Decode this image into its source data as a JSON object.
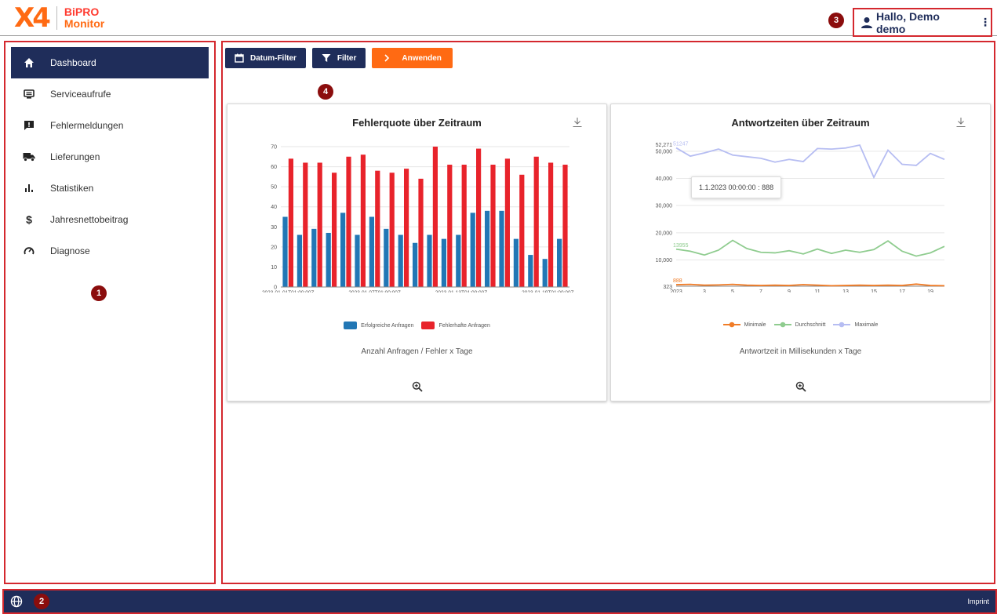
{
  "header": {
    "logo_mark": "X4",
    "logo_line1": "BiPRO",
    "logo_line2": "Monitor",
    "user_label": "Hallo, Demo demo",
    "menu_icon": "more-vert-icon"
  },
  "badges": [
    "1",
    "2",
    "3",
    "4"
  ],
  "sidebar": {
    "items": [
      {
        "label": "Dashboard",
        "icon": "home-icon",
        "active": true
      },
      {
        "label": "Serviceaufrufe",
        "icon": "monitor-icon",
        "active": false
      },
      {
        "label": "Fehlermeldungen",
        "icon": "error-message-icon",
        "active": false
      },
      {
        "label": "Lieferungen",
        "icon": "truck-icon",
        "active": false
      },
      {
        "label": "Statistiken",
        "icon": "bar-chart-icon",
        "active": false
      },
      {
        "label": "Jahresnettobeitrag",
        "icon": "dollar-icon",
        "active": false
      },
      {
        "label": "Diagnose",
        "icon": "gauge-icon",
        "active": false
      }
    ]
  },
  "toolbar": {
    "date_filter": "Datum-Filter",
    "filter": "Filter",
    "apply": "Anwenden"
  },
  "colors": {
    "navy": "#1f2d5a",
    "orange": "#ff6a13",
    "bar_success": "#2277b5",
    "bar_error": "#e8232b",
    "line_min": "#f07c27",
    "line_avg": "#8fcc8f",
    "line_max": "#b6bdf2"
  },
  "chart_data": [
    {
      "type": "bar",
      "title": "Fehlerquote über Zeitraum",
      "subtitle": "Anzahl Anfragen / Fehler x Tage",
      "xlabel": "",
      "ylabel": "",
      "ylim": [
        0,
        70
      ],
      "yticks": [
        0,
        10,
        20,
        30,
        40,
        50,
        60,
        70
      ],
      "x_tick_labels": [
        "2023-01-01T01:00:00Z",
        "2023-01-07T01:00:00Z",
        "2023-01-13T01:00:00Z",
        "2023-01-19T01:00:00Z"
      ],
      "series": [
        {
          "name": "Erfolgreiche Anfragen",
          "values": [
            35,
            26,
            29,
            27,
            37,
            26,
            35,
            29,
            26,
            22,
            26,
            24,
            26,
            37,
            38,
            38,
            24,
            16,
            14,
            24
          ]
        },
        {
          "name": "Fehlerhafte Anfragen",
          "values": [
            64,
            62,
            62,
            57,
            65,
            66,
            58,
            57,
            59,
            54,
            70,
            61,
            61,
            69,
            61,
            64,
            56,
            65,
            62,
            61
          ]
        }
      ],
      "legend": "bottom",
      "grid": true
    },
    {
      "type": "line",
      "title": "Antwortzeiten über Zeitraum",
      "subtitle": "Antwortzeit in Millisekunden x Tage",
      "xlabel": "",
      "ylabel": "",
      "ylim": [
        323,
        52271
      ],
      "yticks": [
        10000,
        20000,
        30000,
        40000,
        50000
      ],
      "ytick_labels": [
        "10,000",
        "20,000",
        "30,000",
        "40,000",
        "50,000"
      ],
      "extra_y_labels": [
        "52,271",
        "323"
      ],
      "x": [
        1,
        2,
        3,
        4,
        5,
        6,
        7,
        8,
        9,
        10,
        11,
        12,
        13,
        14,
        15,
        16,
        17,
        18,
        19,
        20
      ],
      "x_tick_labels": [
        "2023",
        "3",
        "5",
        "7",
        "9",
        "11",
        "13",
        "15",
        "17",
        "19"
      ],
      "series": [
        {
          "name": "Minimale",
          "values": [
            888,
            1000,
            700,
            800,
            1000,
            700,
            600,
            700,
            600,
            900,
            700,
            500,
            600,
            700,
            600,
            700,
            600,
            1100,
            600,
            500
          ]
        },
        {
          "name": "Durchschnitt",
          "values": [
            13955,
            13200,
            11800,
            13600,
            17200,
            14200,
            12800,
            12600,
            13400,
            12200,
            14000,
            12400,
            13600,
            12800,
            13800,
            17000,
            13200,
            11400,
            12600,
            15000
          ]
        },
        {
          "name": "Maximale",
          "values": [
            51247,
            48200,
            49400,
            50800,
            48600,
            48000,
            47400,
            46000,
            47000,
            46200,
            51000,
            50800,
            51200,
            52271,
            40400,
            50400,
            45200,
            44800,
            49200,
            47000
          ]
        }
      ],
      "point_labels": [
        "51247",
        "13955",
        "888"
      ],
      "tooltip": "1.1.2023 00:00:00 : 888",
      "legend": "bottom",
      "grid": true
    }
  ],
  "footer": {
    "imprint": "Imprint",
    "globe_icon": "globe-icon"
  }
}
